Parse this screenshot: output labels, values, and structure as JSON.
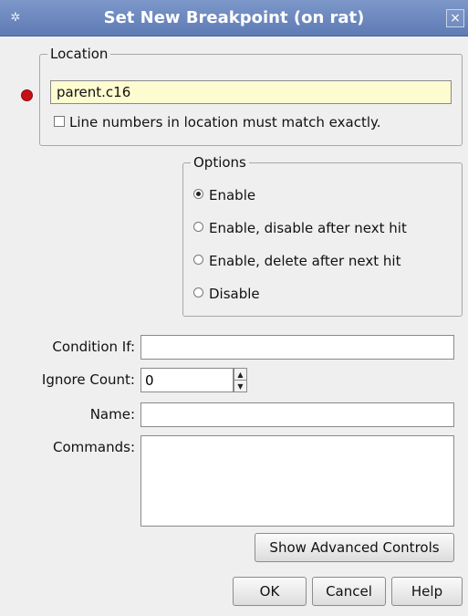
{
  "window": {
    "title": "Set New Breakpoint (on rat)",
    "close_glyph": "×",
    "app_icon": "bug-icon"
  },
  "location": {
    "legend": "Location",
    "value": "parent.c16",
    "match_exactly_label": "Line numbers in location must match exactly.",
    "match_exactly_checked": false
  },
  "options": {
    "legend": "Options",
    "items": [
      {
        "label": "Enable",
        "selected": true
      },
      {
        "label": "Enable, disable after next hit",
        "selected": false
      },
      {
        "label": "Enable, delete after next hit",
        "selected": false
      },
      {
        "label": "Disable",
        "selected": false
      }
    ]
  },
  "form": {
    "condition_label": "Condition If:",
    "condition_value": "",
    "ignore_count_label": "Ignore Count:",
    "ignore_count_value": "0",
    "name_label": "Name:",
    "name_value": "",
    "commands_label": "Commands:",
    "commands_value": ""
  },
  "buttons": {
    "advanced": "Show Advanced Controls",
    "ok": "OK",
    "cancel": "Cancel",
    "help": "Help"
  },
  "colors": {
    "title_bar": "#6d89bf",
    "breakpoint_marker": "#c51016",
    "location_field_bg": "#fdfbd0"
  }
}
